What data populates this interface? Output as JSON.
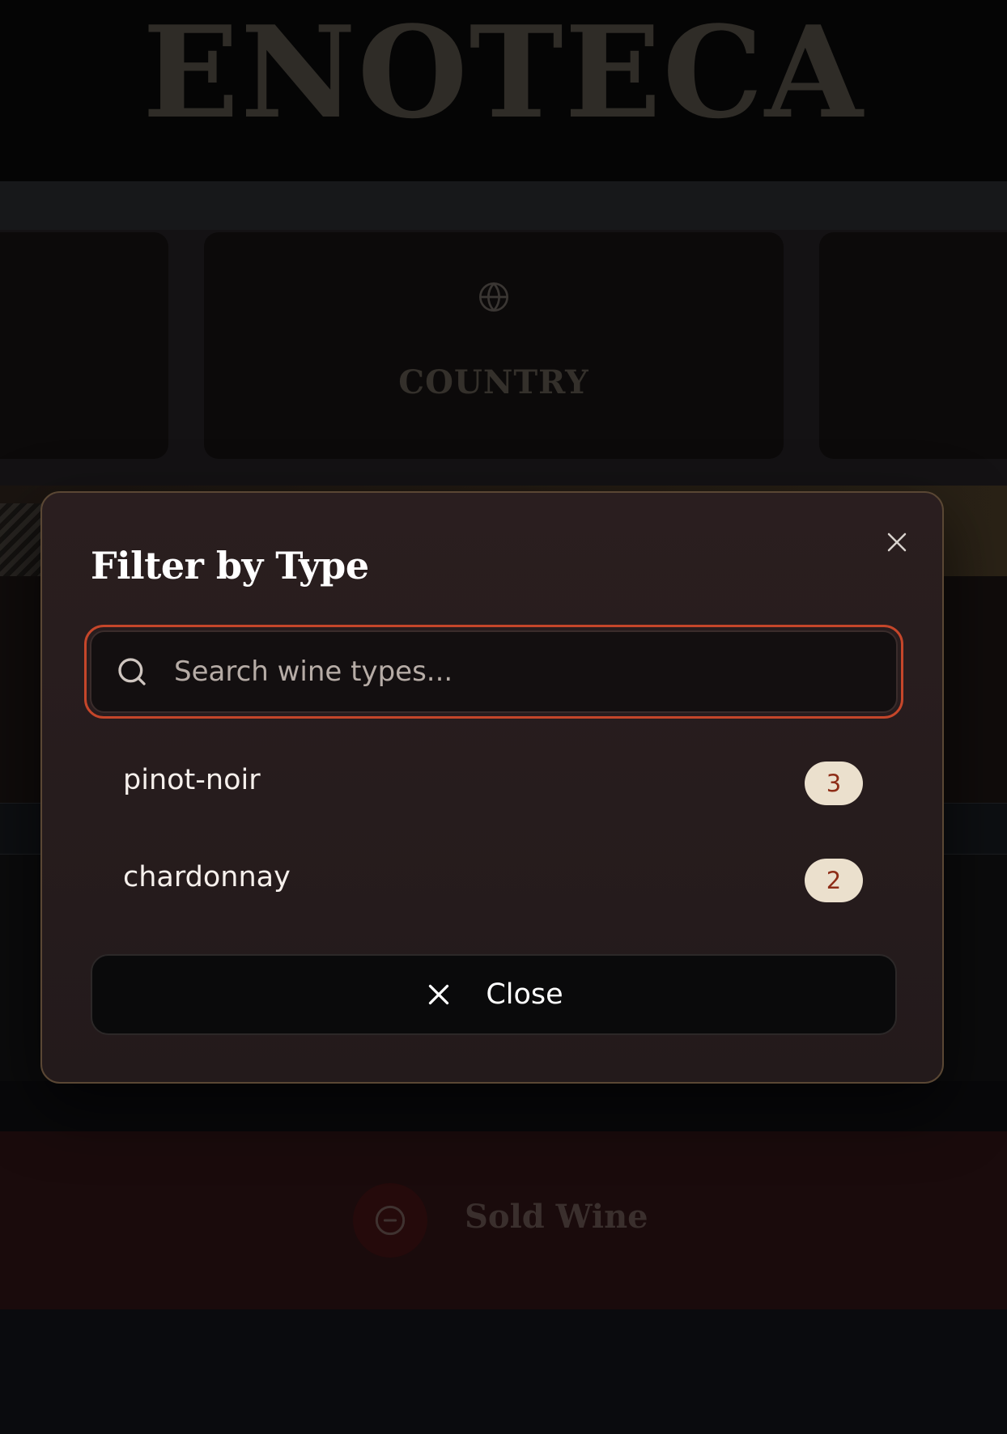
{
  "app": {
    "brand": "ENOTECA"
  },
  "background": {
    "category_card_label": "COUNTRY",
    "category_card_icon": "globe-icon",
    "sold_wine_label": "Sold Wine",
    "sold_wine_icon": "minus-circle-icon"
  },
  "modal": {
    "title": "Filter by Type",
    "close_icon": "close-icon",
    "search": {
      "placeholder": "Search wine types...",
      "value": "",
      "icon": "search-icon"
    },
    "options": [
      {
        "label": "pinot-noir",
        "count": "3"
      },
      {
        "label": "chardonnay",
        "count": "2"
      }
    ],
    "close_button": {
      "label": "Close",
      "icon": "close-icon"
    }
  },
  "colors": {
    "accent_focus_border": "#c5462a",
    "count_badge_bg": "#ebe0cd",
    "count_badge_text": "#8e2d17",
    "modal_border": "#5a4734",
    "modal_bg": "#2a1e1f"
  }
}
